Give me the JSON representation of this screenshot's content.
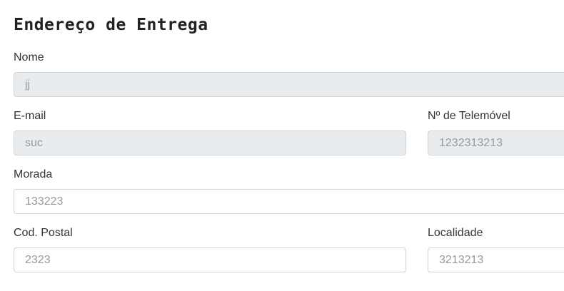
{
  "form": {
    "title": "Endereço de Entrega",
    "fields": {
      "nome": {
        "label": "Nome",
        "placeholder": "jj",
        "readonly": true
      },
      "email": {
        "label": "E-mail",
        "placeholder": "suc",
        "readonly": true
      },
      "telemovel": {
        "label": "Nº de Telemóvel",
        "placeholder": "1232313213",
        "readonly": true
      },
      "morada": {
        "label": "Morada",
        "placeholder": "133223",
        "readonly": false
      },
      "cod_postal": {
        "label": "Cod. Postal",
        "placeholder": "2323",
        "readonly": false
      },
      "localidade": {
        "label": "Localidade",
        "placeholder": "3213213",
        "readonly": false
      }
    }
  }
}
